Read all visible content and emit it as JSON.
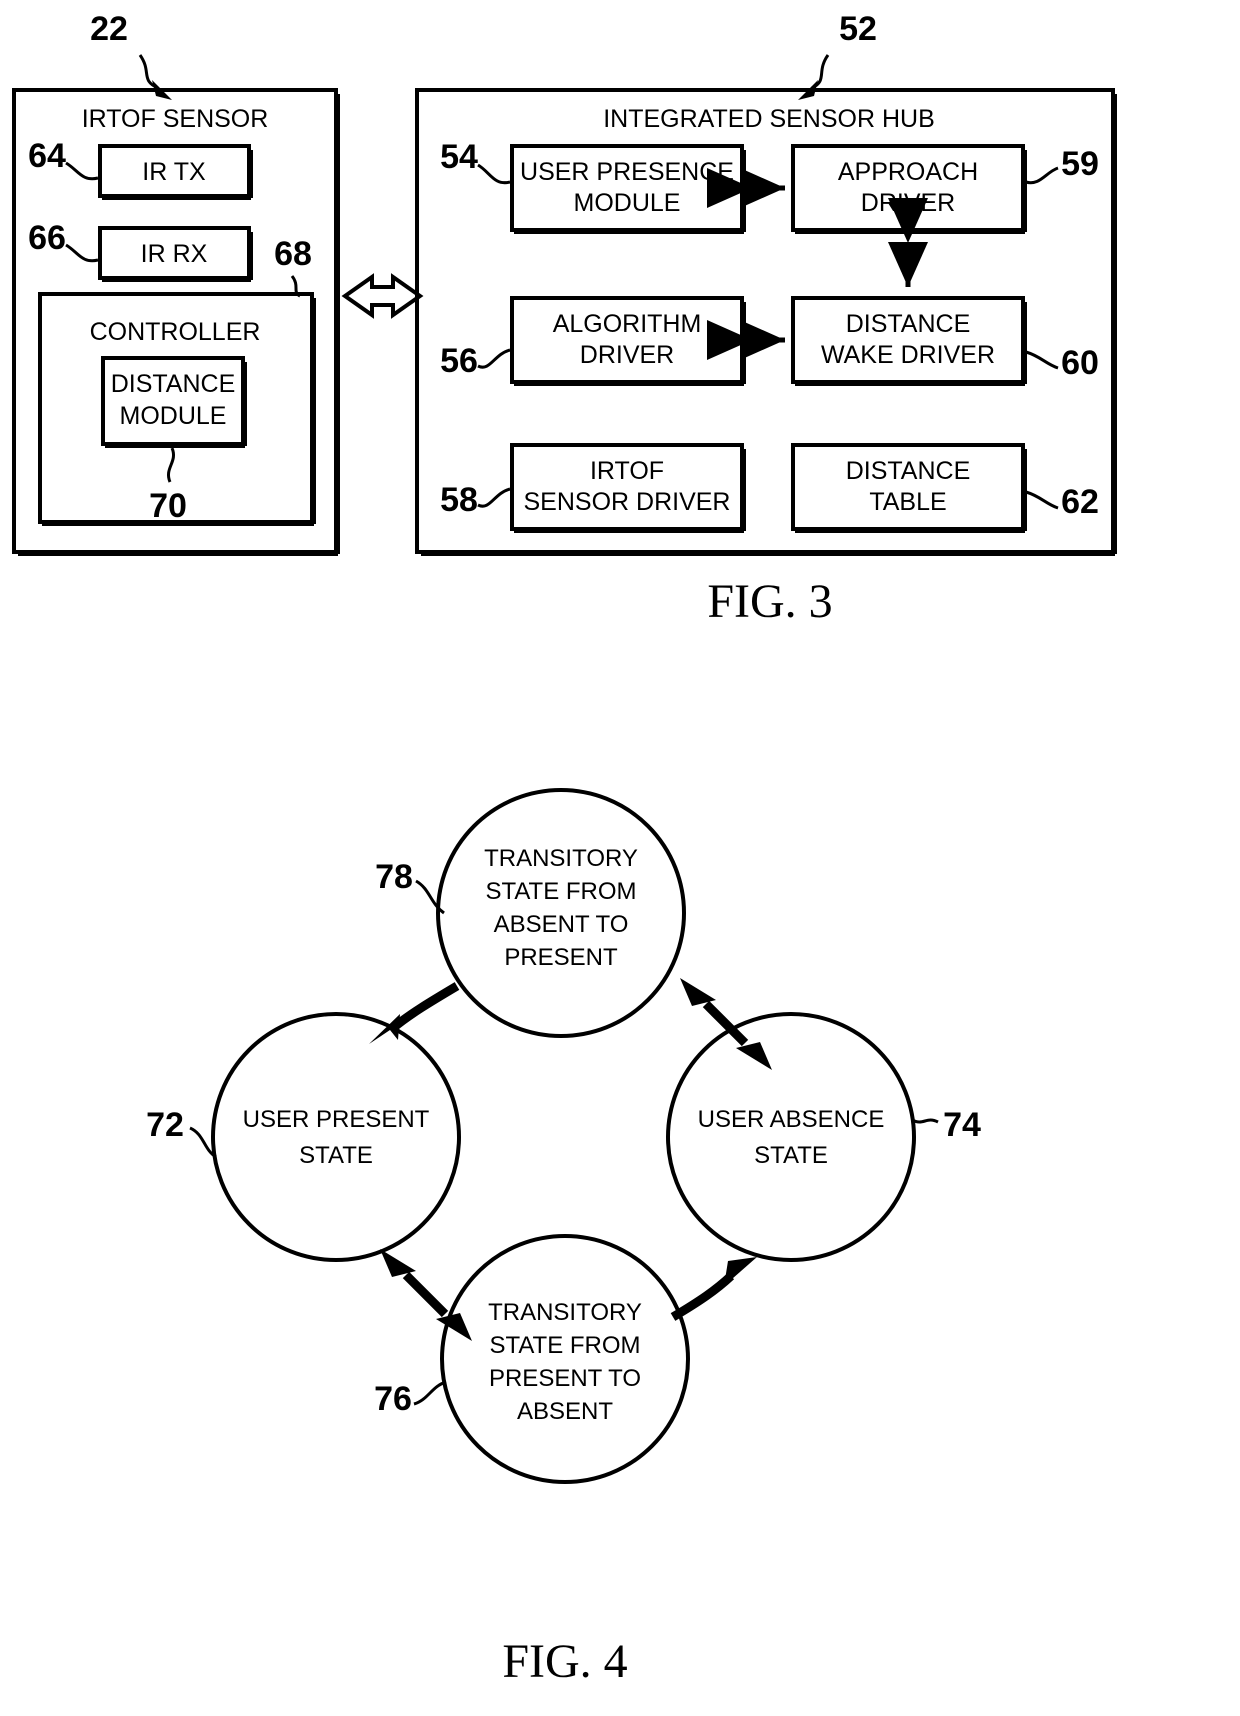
{
  "document": {
    "type": "patent-figure-sheet",
    "figures": [
      "FIG. 3",
      "FIG. 4"
    ]
  },
  "fig3": {
    "caption": "FIG. 3",
    "sensor_block": {
      "title": "IRTOF SENSOR",
      "ref": "22",
      "children": [
        {
          "ref": "64",
          "label": "IR TX"
        },
        {
          "ref": "66",
          "label": "IR RX"
        },
        {
          "ref": "68",
          "label": "CONTROLLER"
        },
        {
          "ref": "70",
          "label_line1": "DISTANCE",
          "label_line2": "MODULE",
          "label": "DISTANCE MODULE"
        }
      ]
    },
    "hub_block": {
      "title": "INTEGRATED SENSOR HUB",
      "ref": "52",
      "modules": [
        {
          "ref": "54",
          "line1": "USER PRESENCE",
          "line2": "MODULE"
        },
        {
          "ref": "59",
          "line1": "APPROACH",
          "line2": "DRIVER"
        },
        {
          "ref": "56",
          "line1": "ALGORITHM",
          "line2": "DRIVER"
        },
        {
          "ref": "60",
          "line1": "DISTANCE",
          "line2": "WAKE DRIVER"
        },
        {
          "ref": "58",
          "line1": "IRTOF",
          "line2": "SENSOR DRIVER"
        },
        {
          "ref": "62",
          "line1": "DISTANCE",
          "line2": "TABLE"
        }
      ]
    },
    "connectors": [
      {
        "name": "sensor-hub-link",
        "style": "hollow-double-arrow"
      },
      {
        "name": "presence-approach-link",
        "style": "solid-double-arrow"
      },
      {
        "name": "approach-wake-link",
        "style": "solid-double-arrow"
      },
      {
        "name": "algorithm-wake-link",
        "style": "solid-double-arrow"
      }
    ]
  },
  "fig4": {
    "caption": "FIG. 4",
    "states": [
      {
        "ref": "78",
        "name": "transitory-absent-to-present",
        "lines": [
          "TRANSITORY",
          "STATE FROM",
          "ABSENT TO",
          "PRESENT"
        ]
      },
      {
        "ref": "72",
        "name": "user-present-state",
        "lines": [
          "USER PRESENT",
          "STATE"
        ]
      },
      {
        "ref": "74",
        "name": "user-absence-state",
        "lines": [
          "USER ABSENCE",
          "STATE"
        ]
      },
      {
        "ref": "76",
        "name": "transitory-present-to-absent",
        "lines": [
          "TRANSITORY",
          "STATE FROM",
          "PRESENT TO",
          "ABSENT"
        ]
      }
    ],
    "transitions": [
      {
        "name": "absent-to-present-to-user-present",
        "style": "single-arrow"
      },
      {
        "name": "absent-to-present-to-user-absence",
        "style": "double-arrow"
      },
      {
        "name": "user-present-to-present-to-absent",
        "style": "double-arrow"
      },
      {
        "name": "present-to-absent-to-user-absence",
        "style": "single-arrow"
      }
    ]
  },
  "colors": {
    "ink": "#000000",
    "paper": "#ffffff"
  }
}
